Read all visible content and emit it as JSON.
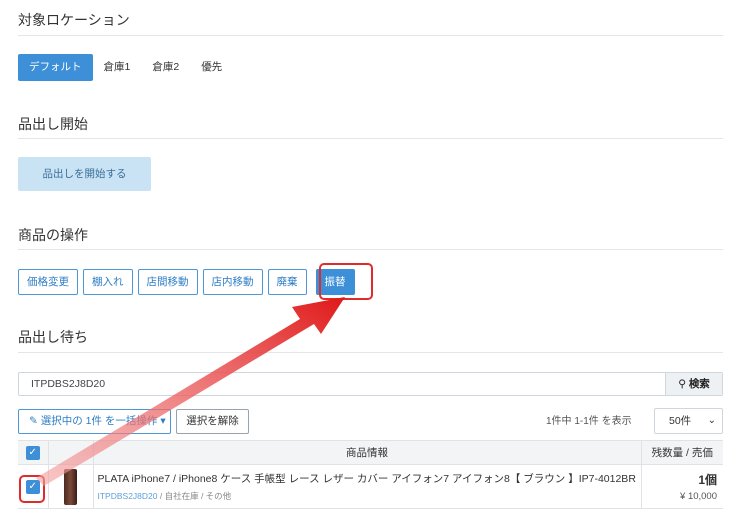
{
  "sections": {
    "target_location": "対象ロケーション",
    "picking_start": "品出し開始",
    "product_ops": "商品の操作",
    "picking_wait": "品出し待ち"
  },
  "location_tabs": [
    "デフォルト",
    "倉庫1",
    "倉庫2",
    "優先"
  ],
  "start_button": "品出しを開始する",
  "operations": [
    "価格変更",
    "棚入れ",
    "店間移動",
    "店内移動",
    "廃棄",
    "振替"
  ],
  "search": {
    "value": "ITPDBS2J8D20",
    "button": "検索"
  },
  "bulk": {
    "bulk_action": "選択中の 1件 を一括操作 ▾",
    "clear": "選択を解除"
  },
  "pagination": {
    "info": "1件中 1-1件 を表示",
    "per_page": "50件"
  },
  "table": {
    "headers": {
      "info": "商品情報",
      "price": "残数量 / 売価"
    },
    "rows": [
      {
        "name": "PLATA iPhone7 / iPhone8 ケース 手帳型 レース レザー カバー アイフォン7 アイフォン8【 ブラウン 】IP7-4012BR",
        "code": "ITPDBS2J8D20",
        "meta": " / 自社在庫 / その他",
        "qty": "1個",
        "price": "¥ 10,000"
      }
    ]
  },
  "colors": {
    "accent": "#3d8fd7",
    "highlight": "#e02b2b"
  }
}
